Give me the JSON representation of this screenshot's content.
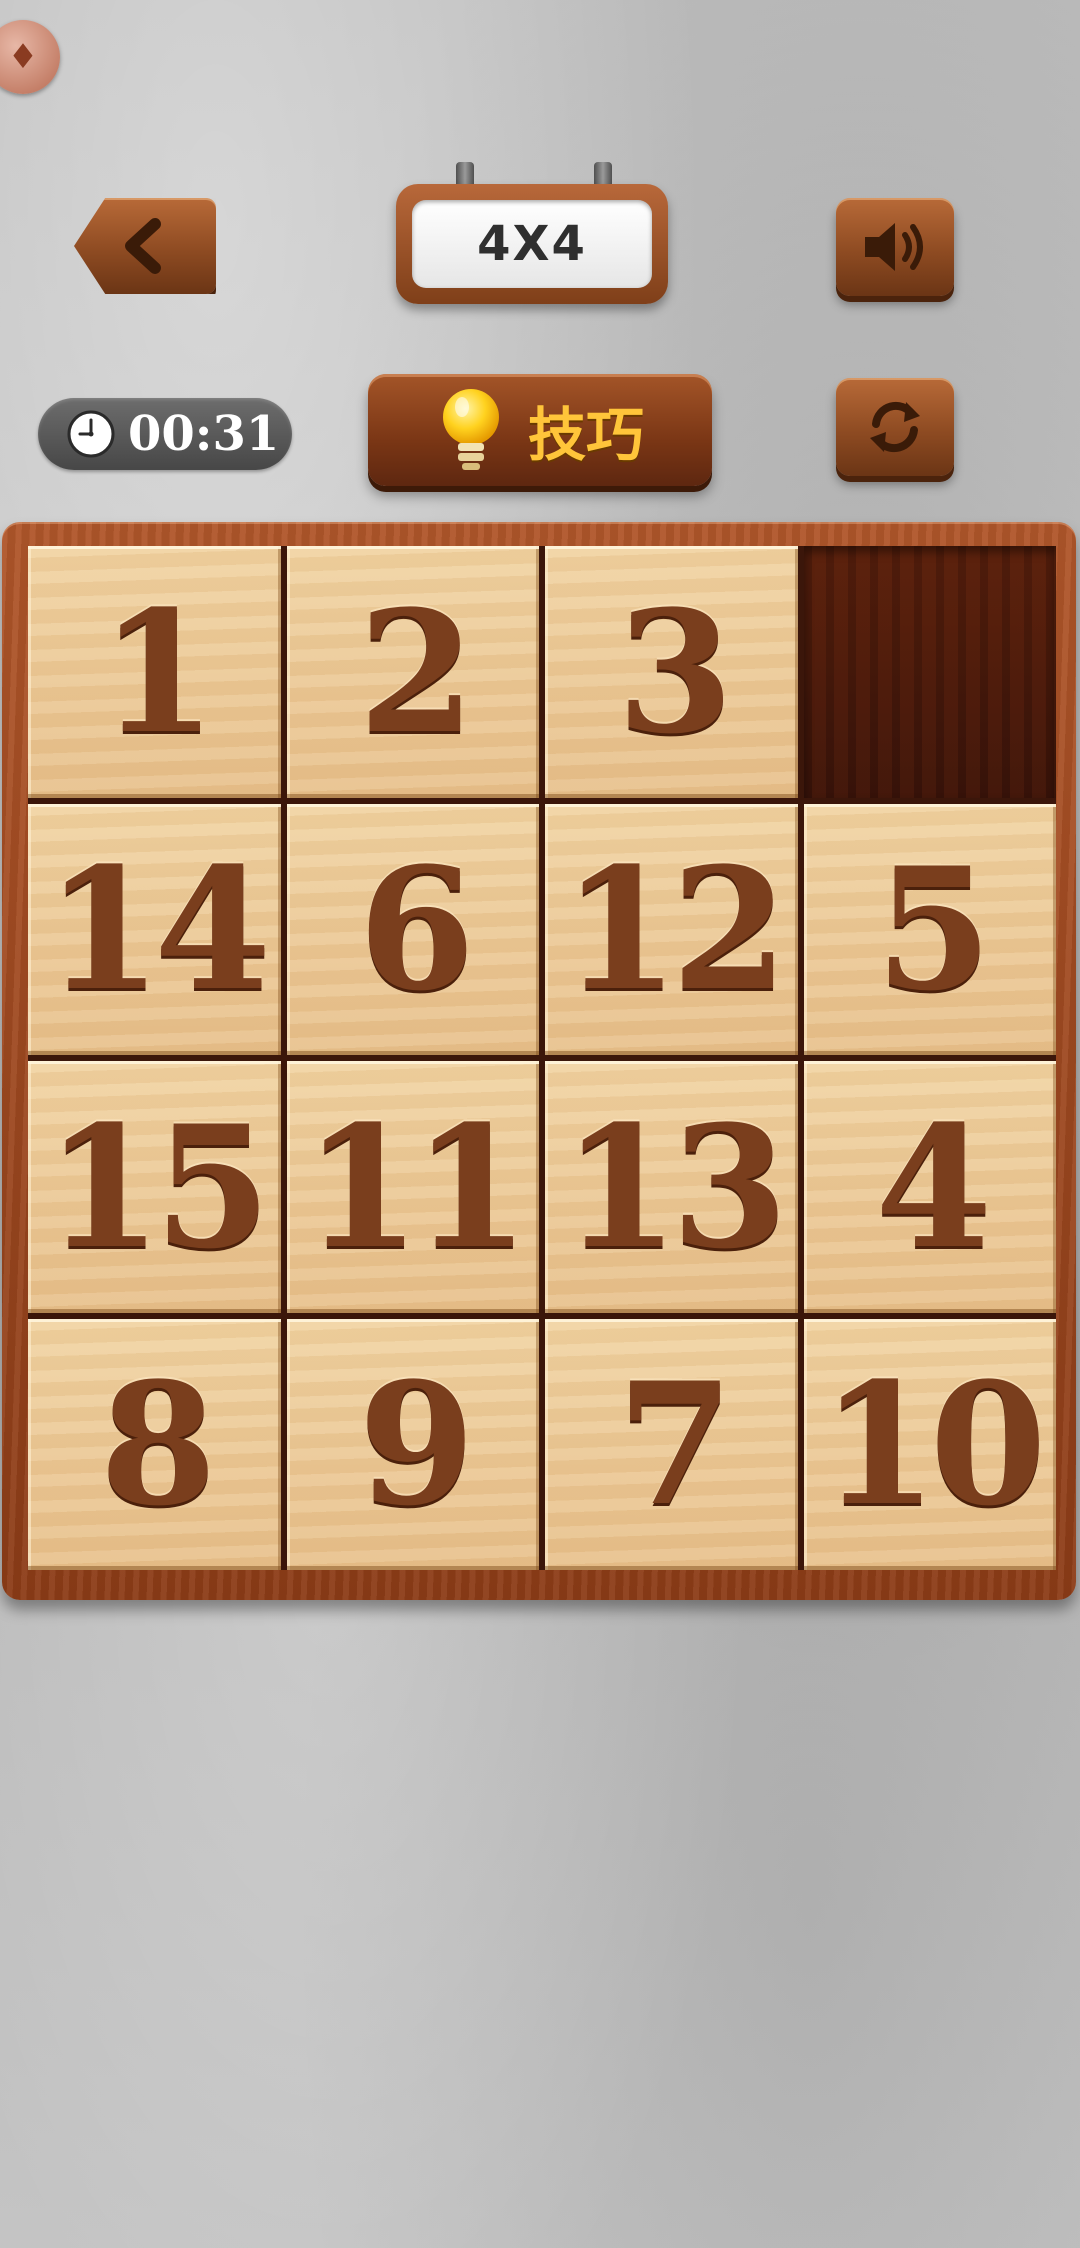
{
  "header": {
    "level_label": "4X4",
    "back_icon": "chevron-left-icon",
    "sound_icon": "speaker-icon",
    "restart_icon": "refresh-icon",
    "badge_icon": "treasure-chest-icon"
  },
  "timer": {
    "icon": "clock-icon",
    "value": "00:31"
  },
  "tips": {
    "icon": "lightbulb-icon",
    "label": "技巧"
  },
  "board": {
    "size": "4x4",
    "tiles": [
      "1",
      "2",
      "3",
      "",
      "14",
      "6",
      "12",
      "5",
      "15",
      "11",
      "13",
      "4",
      "8",
      "9",
      "7",
      "10"
    ]
  },
  "colors": {
    "wood_dark": "#7a3615",
    "tile_light": "#ecc894",
    "number": "#7a3e1d",
    "tips_text": "#ffc53a"
  }
}
